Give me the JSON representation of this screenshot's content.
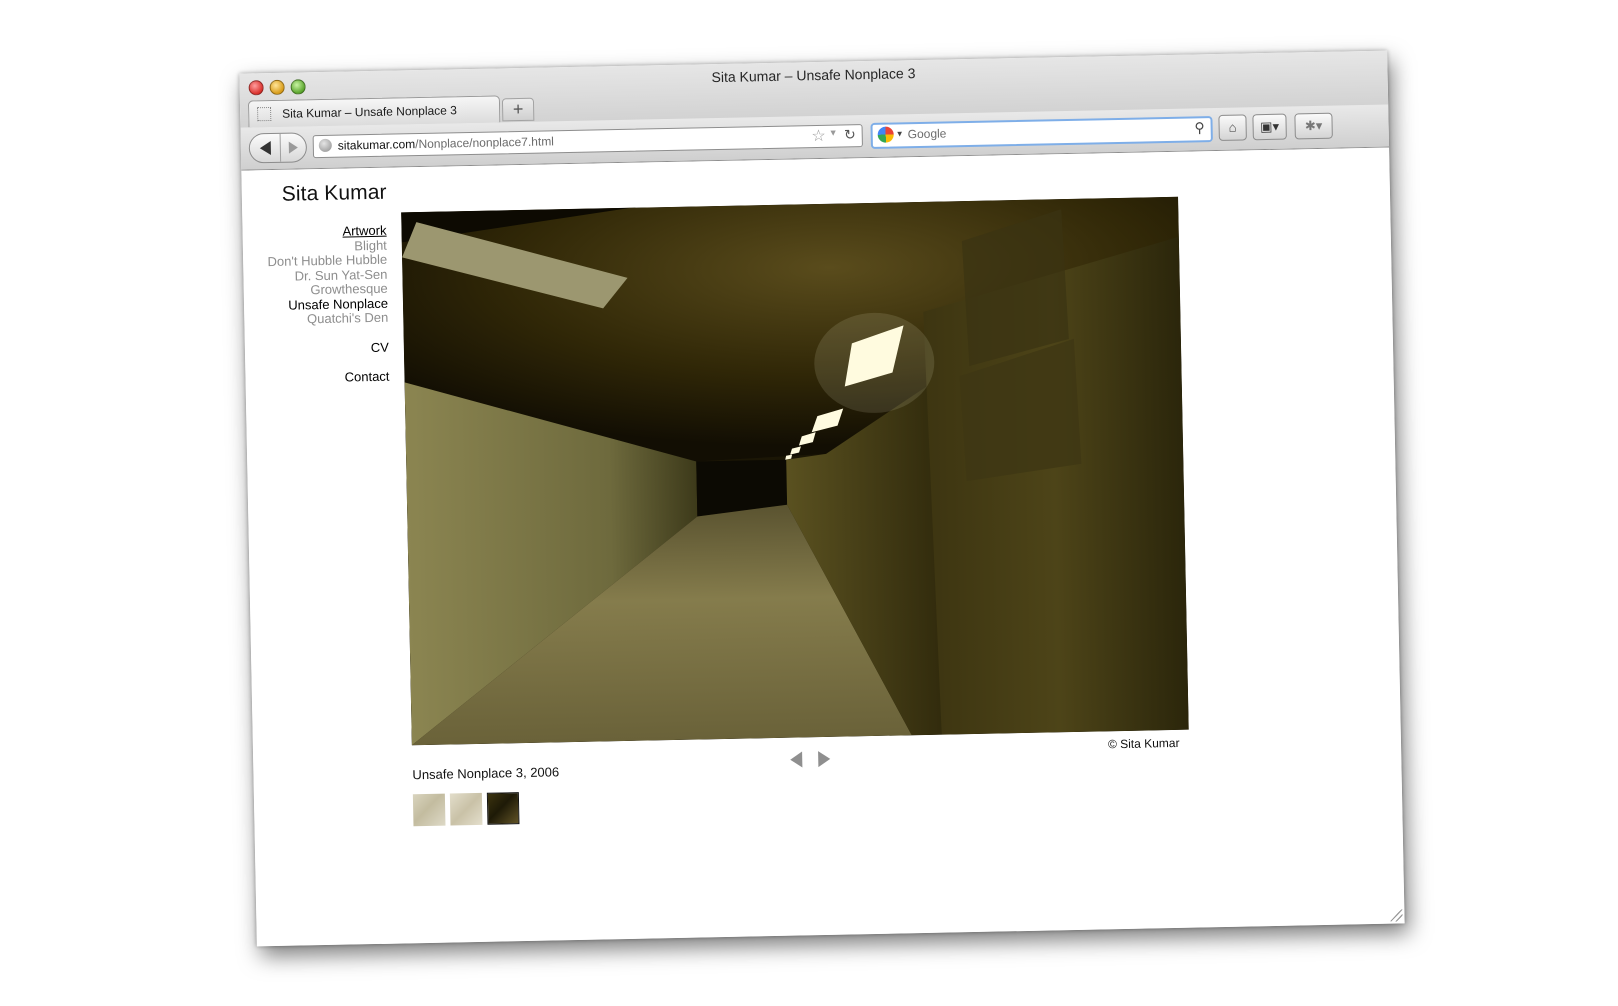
{
  "window": {
    "title": "Sita Kumar – Unsafe Nonplace 3"
  },
  "tabs": [
    {
      "label": "Sita Kumar – Unsafe Nonplace 3"
    }
  ],
  "new_tab_label": "+",
  "address_bar": {
    "domain": "sitakumar.com",
    "path": "/Nonplace/nonplace7.html"
  },
  "search_bar": {
    "placeholder": "Google"
  },
  "site": {
    "title": "Sita Kumar",
    "nav": {
      "artwork": "Artwork",
      "projects": [
        {
          "label": "Blight",
          "active": false
        },
        {
          "label": "Don't Hubble Hubble",
          "active": false
        },
        {
          "label": "Dr. Sun Yat-Sen",
          "active": false
        },
        {
          "label": "Growthesque",
          "active": false
        },
        {
          "label": "Unsafe Nonplace",
          "active": true
        },
        {
          "label": "Quatchi's Den",
          "active": false
        }
      ],
      "cv": "CV",
      "contact": "Contact"
    },
    "artwork": {
      "caption": "Unsafe Nonplace 3, 2006",
      "copyright": "© Sita Kumar",
      "thumbnail_count": 3,
      "selected_thumbnail": 3
    }
  },
  "colors": {
    "search_focus_border": "#7eaee8",
    "nav_inactive": "#8d8d8d",
    "nav_active": "#000000"
  }
}
